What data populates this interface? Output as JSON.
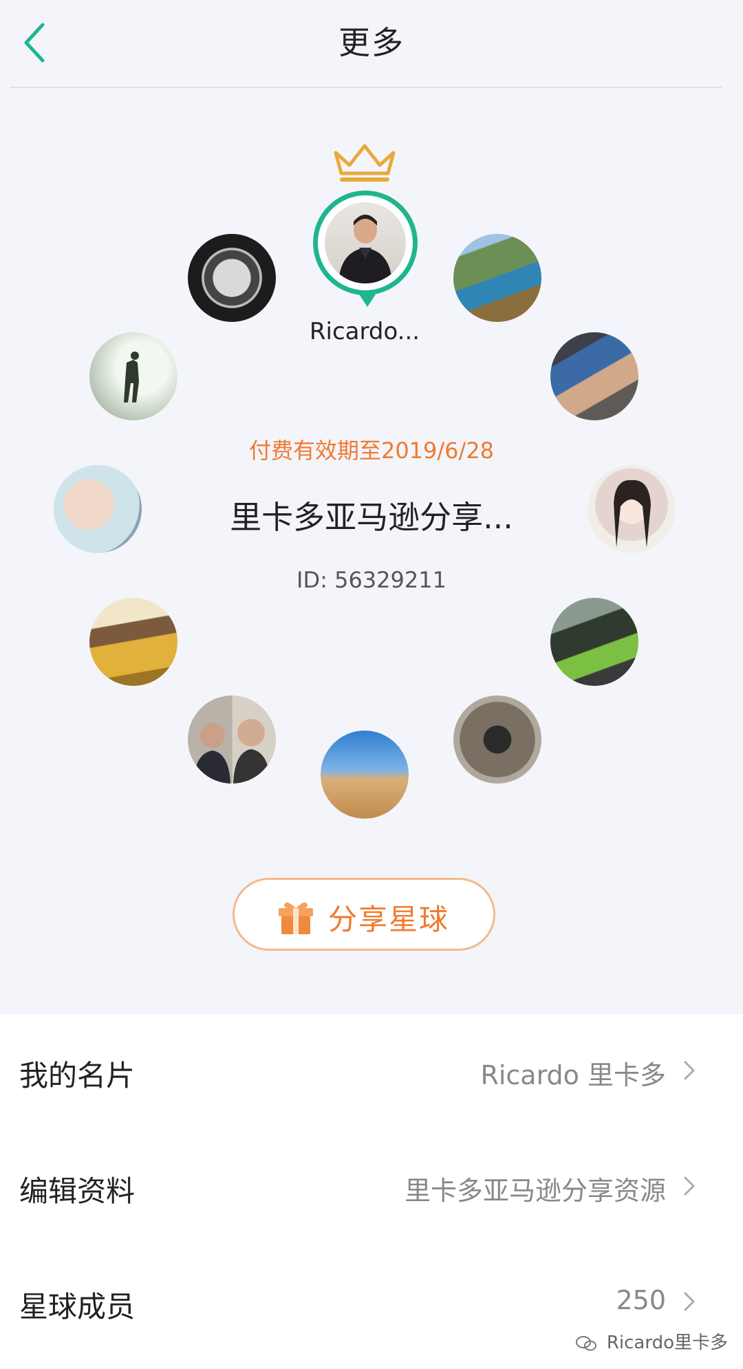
{
  "header": {
    "title": "更多",
    "back_icon": "chevron-left-icon"
  },
  "owner": {
    "name": "Ricardo...",
    "crown_icon": "crown-icon"
  },
  "group": {
    "expiry": "付费有效期至2019/6/28",
    "name": "里卡多亚马逊分享...",
    "id_text": "ID: 56329211"
  },
  "share_button": {
    "label": "分享星球",
    "icon": "gift-icon"
  },
  "rows": [
    {
      "label": "我的名片",
      "value": "Ricardo 里卡多"
    },
    {
      "label": "编辑资料",
      "value": "里卡多亚马逊分享资源"
    },
    {
      "label": "星球成员",
      "value": "250"
    }
  ],
  "watermark": "Ricardo里卡多",
  "colors": {
    "accent_green": "#20b58f",
    "accent_orange": "#f07a2f",
    "crown_gold": "#e8a93a"
  }
}
